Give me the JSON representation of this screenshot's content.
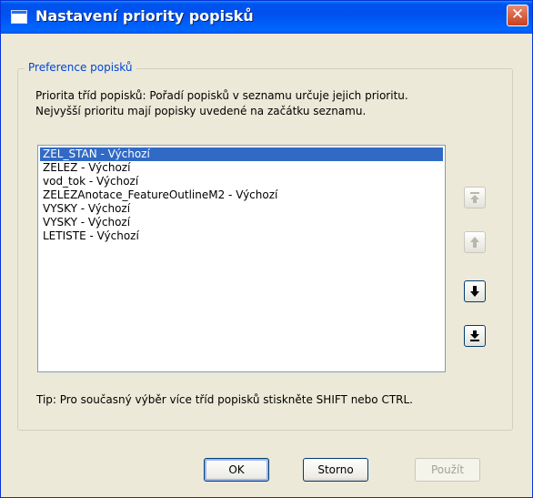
{
  "window": {
    "title": "Nastavení priority popisků",
    "close_glyph": "✕"
  },
  "group": {
    "title": "Preference popisků",
    "description_line1": "Priorita tříd popisků: Pořadí popisků v seznamu určuje jejich prioritu.",
    "description_line2": "Nejvyšší prioritu mají popisky uvedené na začátku seznamu."
  },
  "list": {
    "items": [
      "ZEL_STAN - Výchozí",
      "ZELEZ - Výchozí",
      "vod_tok - Výchozí",
      "ZELEZAnotace_FeatureOutlineM2 - Výchozí",
      "VYSKY - Výchozí",
      "VYSKY - Výchozí",
      "LETISTE - Výchozí"
    ],
    "selected_index": 0
  },
  "arrows": {
    "move_top": {
      "icon": "move-to-top-icon",
      "enabled": false
    },
    "move_up": {
      "icon": "move-up-icon",
      "enabled": false
    },
    "move_down": {
      "icon": "move-down-icon",
      "enabled": true
    },
    "move_bottom": {
      "icon": "move-to-bottom-icon",
      "enabled": true
    }
  },
  "tip": "Tip: Pro současný výběr více tříd popisků stiskněte SHIFT nebo CTRL.",
  "buttons": {
    "ok": "OK",
    "cancel": "Storno",
    "apply": "Použít"
  },
  "colors": {
    "title_bar": "#0053ee",
    "selection": "#316ac5",
    "group_title": "#0046d5",
    "dialog_bg": "#ece9d8"
  }
}
